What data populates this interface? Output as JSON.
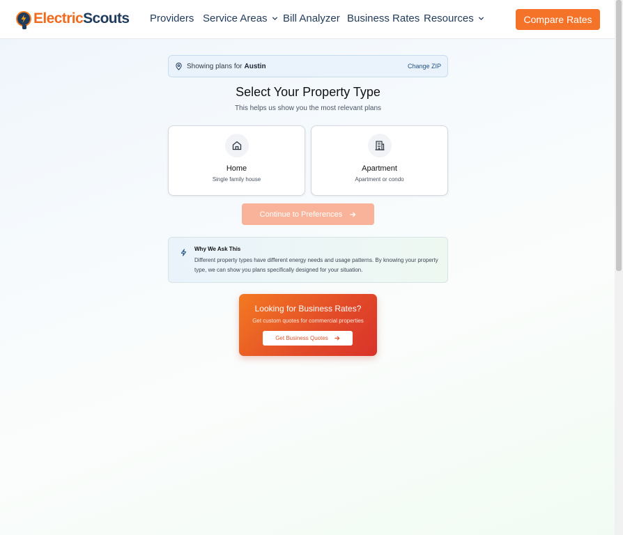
{
  "header": {
    "logo_part1": "Electric",
    "logo_part2": "Scouts",
    "nav": [
      {
        "label": "Providers",
        "has_dropdown": false
      },
      {
        "label": "Service Areas",
        "has_dropdown": true
      },
      {
        "label": "Bill Analyzer",
        "has_dropdown": false
      },
      {
        "label": "Business Rates",
        "has_dropdown": false
      },
      {
        "label": "Resources",
        "has_dropdown": true
      }
    ],
    "cta_label": "Compare Rates"
  },
  "zip_bar": {
    "prefix": "Showing plans for",
    "city": "Austin",
    "change_label": "Change ZIP",
    "icon": "map-pin-icon"
  },
  "page": {
    "title": "Select Your Property Type",
    "subtitle": "This helps us show you the most relevant plans"
  },
  "property_types": [
    {
      "title": "Home",
      "description": "Single family house",
      "icon": "house-icon"
    },
    {
      "title": "Apartment",
      "description": "Apartment or condo",
      "icon": "building-icon"
    }
  ],
  "continue_label": "Continue to Preferences",
  "why": {
    "title": "Why We Ask This",
    "body": "Different property types have different energy needs and usage patterns. By knowing your property type, we can show you plans specifically designed for your situation.",
    "icon": "lightning-icon"
  },
  "business": {
    "title": "Looking for Business Rates?",
    "subtitle": "Get custom quotes for commercial properties",
    "button_label": "Get Business Quotes"
  },
  "colors": {
    "brand_orange": "#f47329",
    "brand_navy": "#1f3a5a",
    "disabled_orange": "#f8b39a"
  }
}
